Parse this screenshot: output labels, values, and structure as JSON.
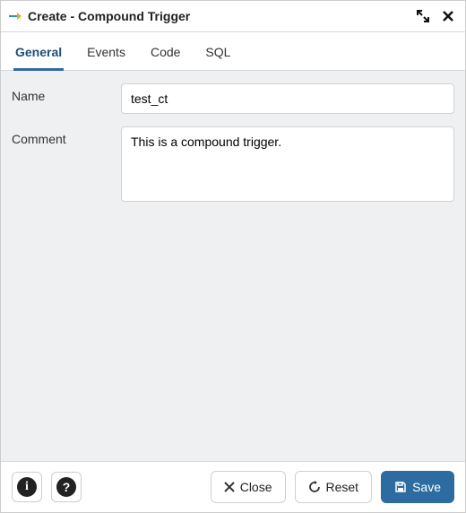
{
  "dialog": {
    "title": "Create - Compound Trigger"
  },
  "tabs": [
    {
      "label": "General",
      "active": true
    },
    {
      "label": "Events",
      "active": false
    },
    {
      "label": "Code",
      "active": false
    },
    {
      "label": "SQL",
      "active": false
    }
  ],
  "form": {
    "name_label": "Name",
    "name_value": "test_ct",
    "comment_label": "Comment",
    "comment_value": "This is a compound trigger."
  },
  "footer": {
    "close_label": "Close",
    "reset_label": "Reset",
    "save_label": "Save"
  }
}
